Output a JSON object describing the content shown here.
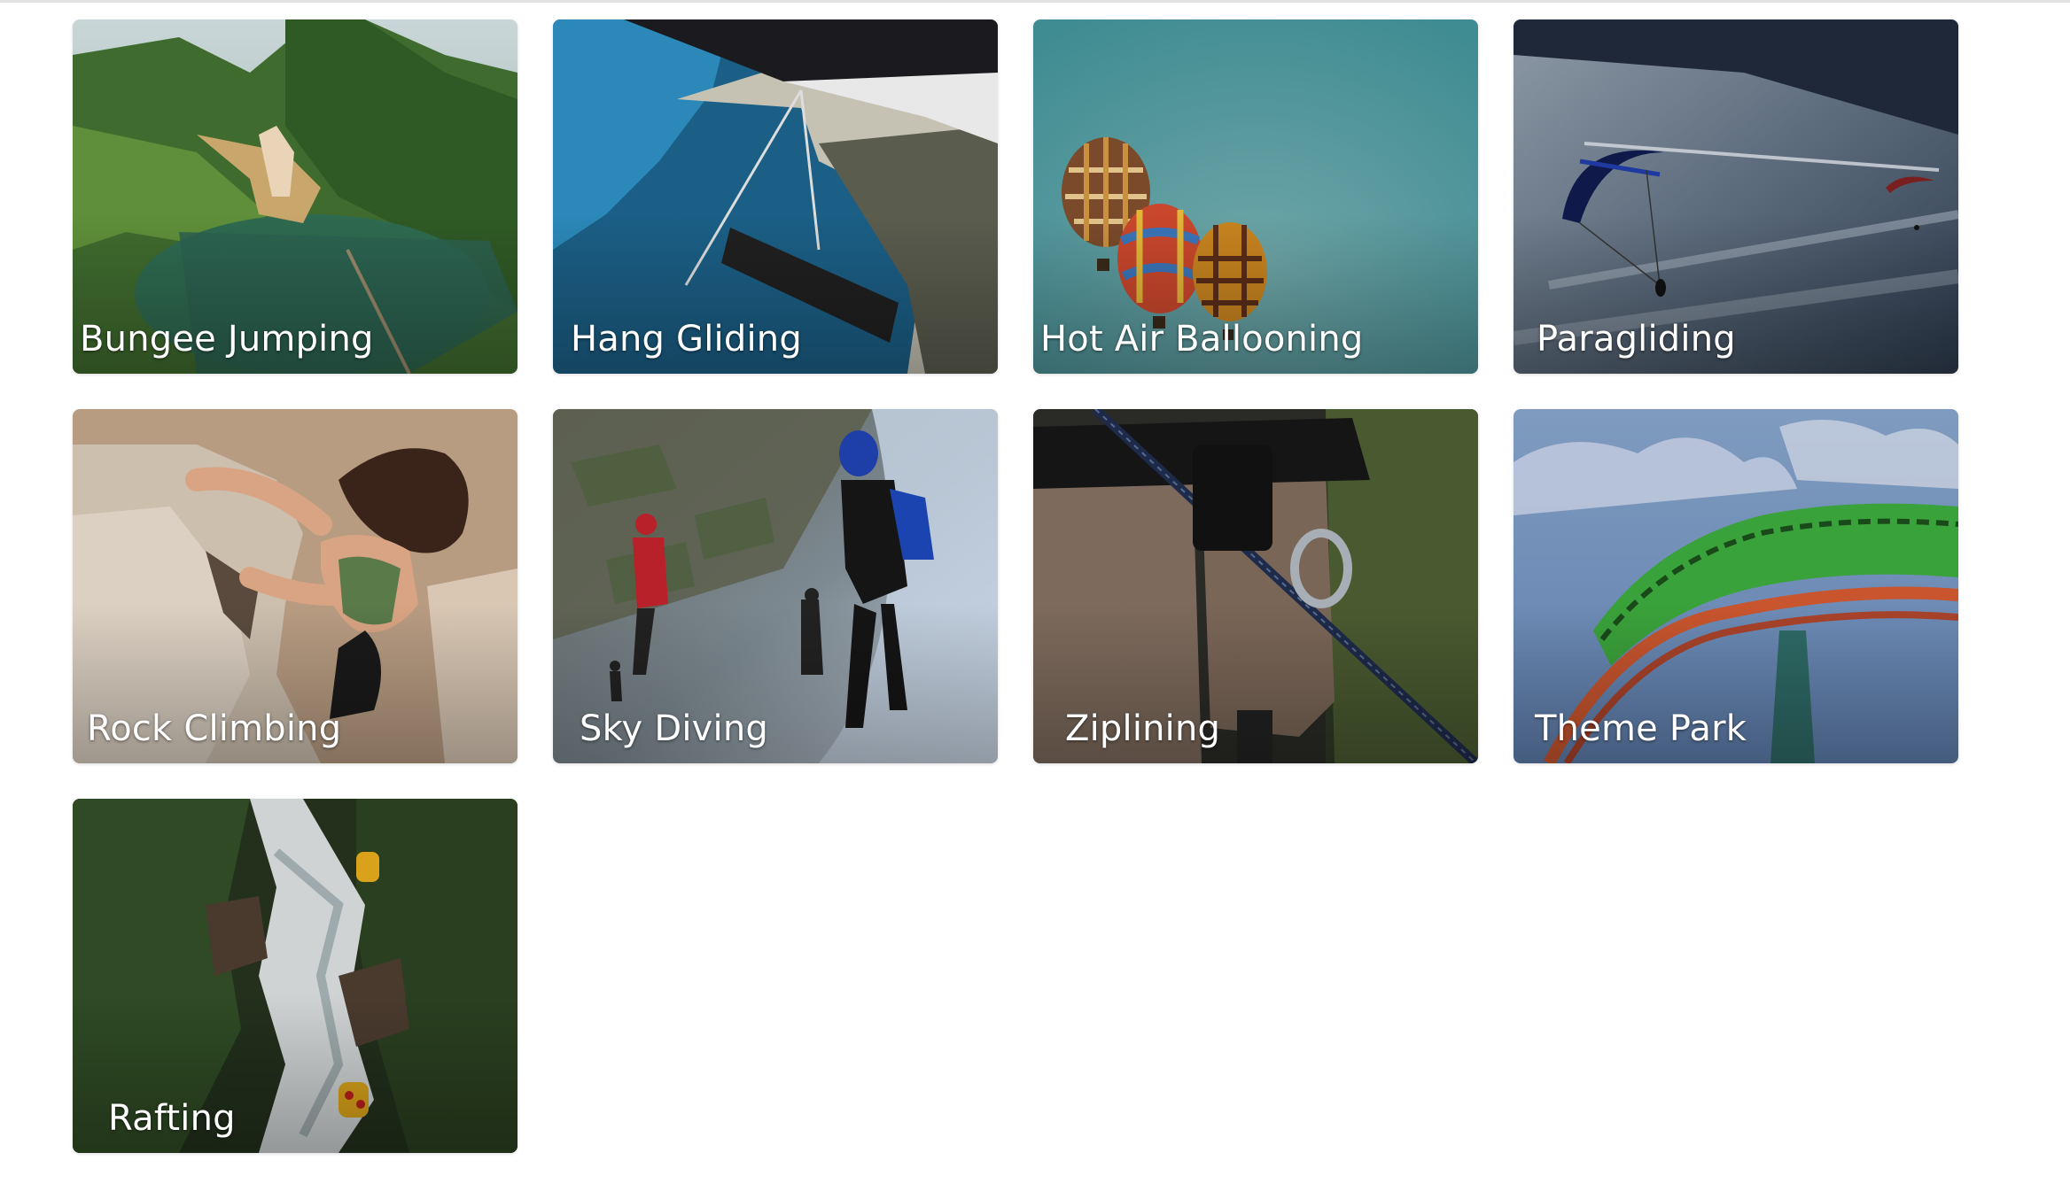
{
  "activities": [
    {
      "label": "Bungee Jumping",
      "icon": "bungee-jumping-photo"
    },
    {
      "label": "Hang Gliding",
      "icon": "hang-gliding-photo"
    },
    {
      "label": "Hot Air Ballooning",
      "icon": "hot-air-balloon-photo"
    },
    {
      "label": "Paragliding",
      "icon": "paragliding-photo"
    },
    {
      "label": "Rock Climbing",
      "icon": "rock-climbing-photo"
    },
    {
      "label": "Sky Diving",
      "icon": "sky-diving-photo"
    },
    {
      "label": "Ziplining",
      "icon": "ziplining-photo"
    },
    {
      "label": "Theme Park",
      "icon": "theme-park-photo"
    },
    {
      "label": "Rafting",
      "icon": "rafting-photo"
    }
  ]
}
